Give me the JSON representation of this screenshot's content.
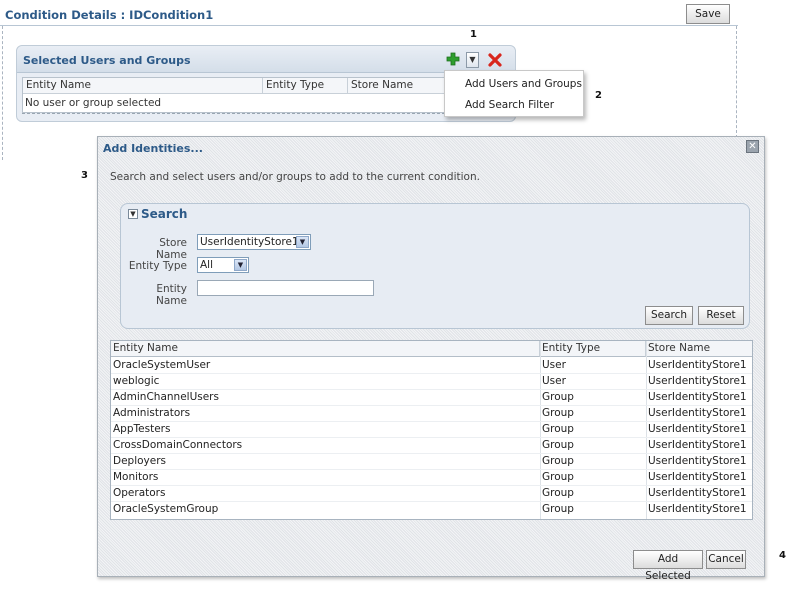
{
  "page": {
    "title": "Condition Details : IDCondition1",
    "save_label": "Save"
  },
  "selected_panel": {
    "title": "Selected Users and Groups",
    "columns": [
      "Entity Name",
      "Entity Type",
      "Store Name"
    ],
    "empty_text": "No user or group selected",
    "add_icon": "plus-icon",
    "delete_icon": "x-icon"
  },
  "add_menu": {
    "items": [
      "Add Users and Groups",
      "Add Search Filter"
    ]
  },
  "callouts": [
    "1",
    "2",
    "3",
    "4"
  ],
  "dialog": {
    "title": "Add Identities...",
    "instructions": "Search and select users and/or groups to add to the current condition.",
    "search": {
      "title": "Search",
      "store_name_label": "Store Name",
      "store_name_value": "UserIdentityStore1",
      "entity_type_label": "Entity Type",
      "entity_type_value": "All",
      "entity_name_label": "Entity Name",
      "entity_name_value": "",
      "search_button": "Search",
      "reset_button": "Reset"
    },
    "results": {
      "columns": [
        "Entity Name",
        "Entity Type",
        "Store Name"
      ],
      "rows": [
        [
          "OracleSystemUser",
          "User",
          "UserIdentityStore1"
        ],
        [
          "weblogic",
          "User",
          "UserIdentityStore1"
        ],
        [
          "AdminChannelUsers",
          "Group",
          "UserIdentityStore1"
        ],
        [
          "Administrators",
          "Group",
          "UserIdentityStore1"
        ],
        [
          "AppTesters",
          "Group",
          "UserIdentityStore1"
        ],
        [
          "CrossDomainConnectors",
          "Group",
          "UserIdentityStore1"
        ],
        [
          "Deployers",
          "Group",
          "UserIdentityStore1"
        ],
        [
          "Monitors",
          "Group",
          "UserIdentityStore1"
        ],
        [
          "Operators",
          "Group",
          "UserIdentityStore1"
        ],
        [
          "OracleSystemGroup",
          "Group",
          "UserIdentityStore1"
        ]
      ]
    },
    "add_selected_button": "Add Selected",
    "cancel_button": "Cancel"
  },
  "colors": {
    "title_blue": "#2d5a88",
    "add_green": "#2e9e2e",
    "delete_red": "#d8261d"
  }
}
